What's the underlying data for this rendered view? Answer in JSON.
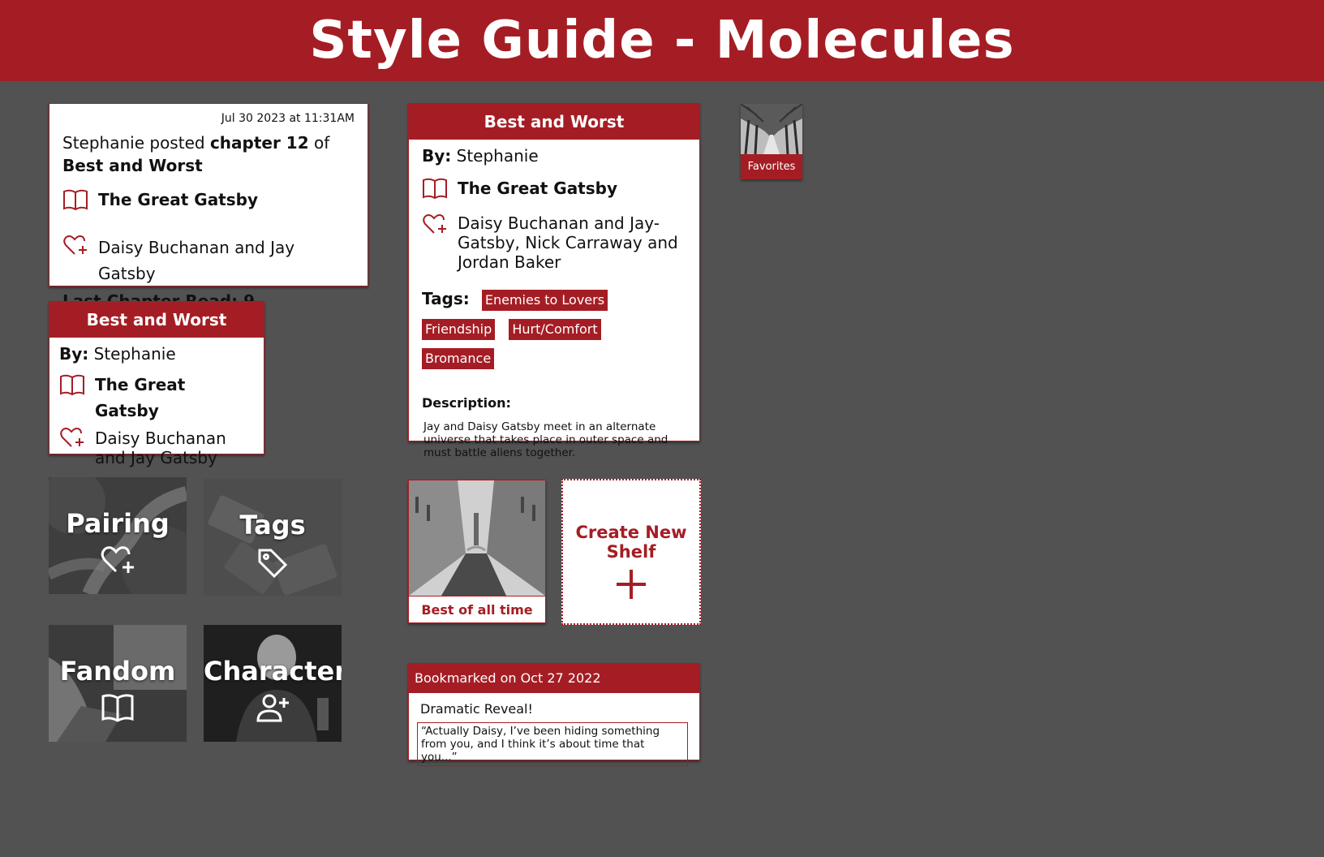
{
  "header": {
    "title": "Style Guide - Molecules"
  },
  "update_card": {
    "timestamp": "Jul 30 2023 at 11:31AM",
    "poster": "Stephanie",
    "posted_text": "posted",
    "chapter_label": "chapter 12",
    "of_text": "of",
    "story_title": "Best and Worst",
    "fandom": "The Great Gatsby",
    "pairing": "Daisy Buchanan and Jay Gatsby",
    "last_read": "Last Chapter Read: 9"
  },
  "small_story_card": {
    "title": "Best and Worst",
    "by_label": "By:",
    "author": "Stephanie",
    "fandom": "The Great Gatsby",
    "pairing": "Daisy Buchanan and Jay Gatsby"
  },
  "large_story_card": {
    "title": "Best and Worst",
    "by_label": "By:",
    "author": "Stephanie",
    "fandom": "The Great Gatsby",
    "pairing": "Daisy Buchanan and Jay-Gatsby, Nick Carraway and Jordan Baker",
    "tags_label": "Tags:",
    "tags": [
      "Enemies to Lovers",
      "Friendship",
      "Hurt/Comfort",
      "Bromance"
    ],
    "description_label": "Description:",
    "description": "Jay and Daisy Gatsby meet in an alternate universe that takes place in outer space and must battle aliens together."
  },
  "favorites": {
    "label": "Favorites"
  },
  "category_tiles": {
    "pairing": "Pairing",
    "tags": "Tags",
    "fandom": "Fandom",
    "character": "Character"
  },
  "shelf": {
    "label": "Best of all time"
  },
  "create_shelf": {
    "label": "Create New Shelf"
  },
  "bookmark": {
    "header": "Bookmarked on Oct 27 2022",
    "title": "Dramatic Reveal!",
    "quote": "“Actually Daisy, I’ve been hiding something from you, and I think it’s about time that you...”"
  },
  "colors": {
    "accent": "#a51d24",
    "background": "#525252"
  }
}
